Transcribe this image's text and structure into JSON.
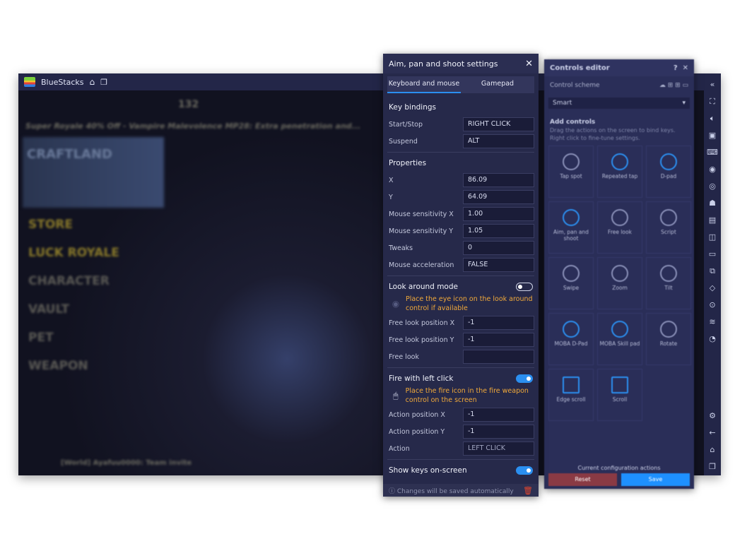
{
  "app": {
    "title": "BlueStacks"
  },
  "game": {
    "banner": "Super Royale 40% Off - Vampire Malevolence MP28: Extra penetration and...",
    "coins": "132",
    "menu": [
      "STORE",
      "LUCK ROYALE",
      "CHARACTER",
      "VAULT",
      "PET",
      "WEAPON"
    ],
    "chat": "[World] Ayafuu0000: Team invite",
    "brand": "CRAFTLAND"
  },
  "settings": {
    "title": "Aim, pan and shoot settings",
    "tabs": [
      "Keyboard and mouse",
      "Gamepad"
    ],
    "key_bindings": {
      "heading": "Key bindings",
      "rows": [
        {
          "label": "Start/Stop",
          "value": "RIGHT CLICK"
        },
        {
          "label": "Suspend",
          "value": "ALT"
        }
      ]
    },
    "properties": {
      "heading": "Properties",
      "rows": [
        {
          "label": "X",
          "value": "86.09"
        },
        {
          "label": "Y",
          "value": "64.09"
        },
        {
          "label": "Mouse sensitivity X",
          "value": "1.00"
        },
        {
          "label": "Mouse sensitivity Y",
          "value": "1.05"
        },
        {
          "label": "Tweaks",
          "value": "0"
        },
        {
          "label": "Mouse acceleration",
          "value": "FALSE"
        }
      ]
    },
    "look_around": {
      "heading": "Look around mode",
      "enabled": false,
      "hint": "Place the eye icon on the look around control if available",
      "rows": [
        {
          "label": "Free look position X",
          "value": "-1"
        },
        {
          "label": "Free look position Y",
          "value": "-1"
        },
        {
          "label": "Free look",
          "value": ""
        }
      ]
    },
    "fire": {
      "heading": "Fire with left click",
      "enabled": true,
      "hint": "Place the fire icon in the fire weapon control on the screen",
      "rows": [
        {
          "label": "Action position X",
          "value": "-1"
        },
        {
          "label": "Action position Y",
          "value": "-1"
        },
        {
          "label": "Action",
          "value": "LEFT CLICK"
        }
      ]
    },
    "show_keys": {
      "heading": "Show keys on-screen",
      "enabled": true
    },
    "footer": "Changes will be saved automatically"
  },
  "editor": {
    "title": "Controls editor",
    "scheme_label": "Control scheme",
    "scheme_value": "Smart",
    "add_heading": "Add controls",
    "add_desc": "Drag the actions on the screen to bind keys. Right click to fine-tune settings.",
    "controls": [
      "Tap spot",
      "Repeated tap",
      "D-pad",
      "Aim, pan and shoot",
      "Free look",
      "Script",
      "Swipe",
      "Zoom",
      "Tilt",
      "MOBA D-Pad",
      "MOBA Skill pad",
      "Rotate",
      "Edge scroll",
      "Scroll"
    ],
    "footer_label": "Current configuration actions",
    "reset": "Reset",
    "save": "Save"
  },
  "colors": {
    "accent": "#2b8ff0",
    "hint": "#f0a93a",
    "panel": "#26294a",
    "reset": "#8a3a44"
  }
}
